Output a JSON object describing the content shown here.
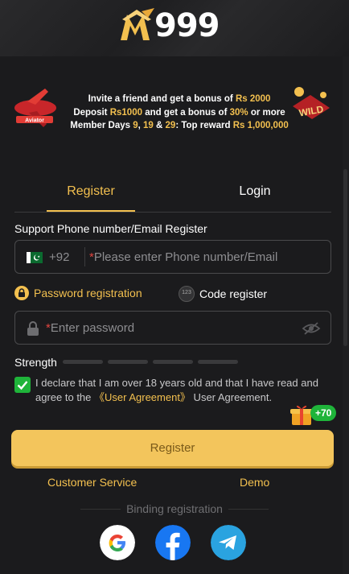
{
  "brand": {
    "logo_text": "999"
  },
  "banner": {
    "line1_pre": "Invite a friend and get a bonus of ",
    "line1_gold": "Rs 2000",
    "line2_pre": "Deposit ",
    "line2_gold1": "Rs1000",
    "line2_mid": " and get a bonus of ",
    "line2_gold2": "30%",
    "line2_post": " or more",
    "line3_pre": "Member Days ",
    "line3_d1": "9",
    "line3_c1": ", ",
    "line3_d2": "19",
    "line3_c2": " & ",
    "line3_d3": "29",
    "line3_mid": ": Top reward ",
    "line3_gold": "Rs 1,000,000"
  },
  "tabs": {
    "register": "Register",
    "login": "Login"
  },
  "form": {
    "section_title": "Support Phone number/Email Register",
    "country_code": "+92",
    "phone_placeholder": "Please enter Phone number/Email",
    "password_registration": "Password registration",
    "code_register": "Code register",
    "code_icon_text": "123",
    "password_placeholder": "Enter password",
    "strength_label": "Strength",
    "declare_pre": "I declare that I am over 18 years old and that I have read and agree to the ",
    "user_agreement_link": "《User Agreement》",
    "declare_post": " User Agreement.",
    "bonus_badge": "+70",
    "register_button": "Register",
    "required_mark": "*"
  },
  "footer": {
    "customer_service": "Customer Service",
    "demo": "Demo",
    "binding_registration": "Binding registration"
  },
  "colors": {
    "accent": "#f3c04f",
    "check": "#1fb43a",
    "button": "#f3c55c"
  },
  "icons": [
    "lock-icon",
    "eye-off-icon",
    "google-icon",
    "facebook-icon",
    "telegram-icon",
    "gift-icon",
    "pakistan-flag-icon"
  ]
}
